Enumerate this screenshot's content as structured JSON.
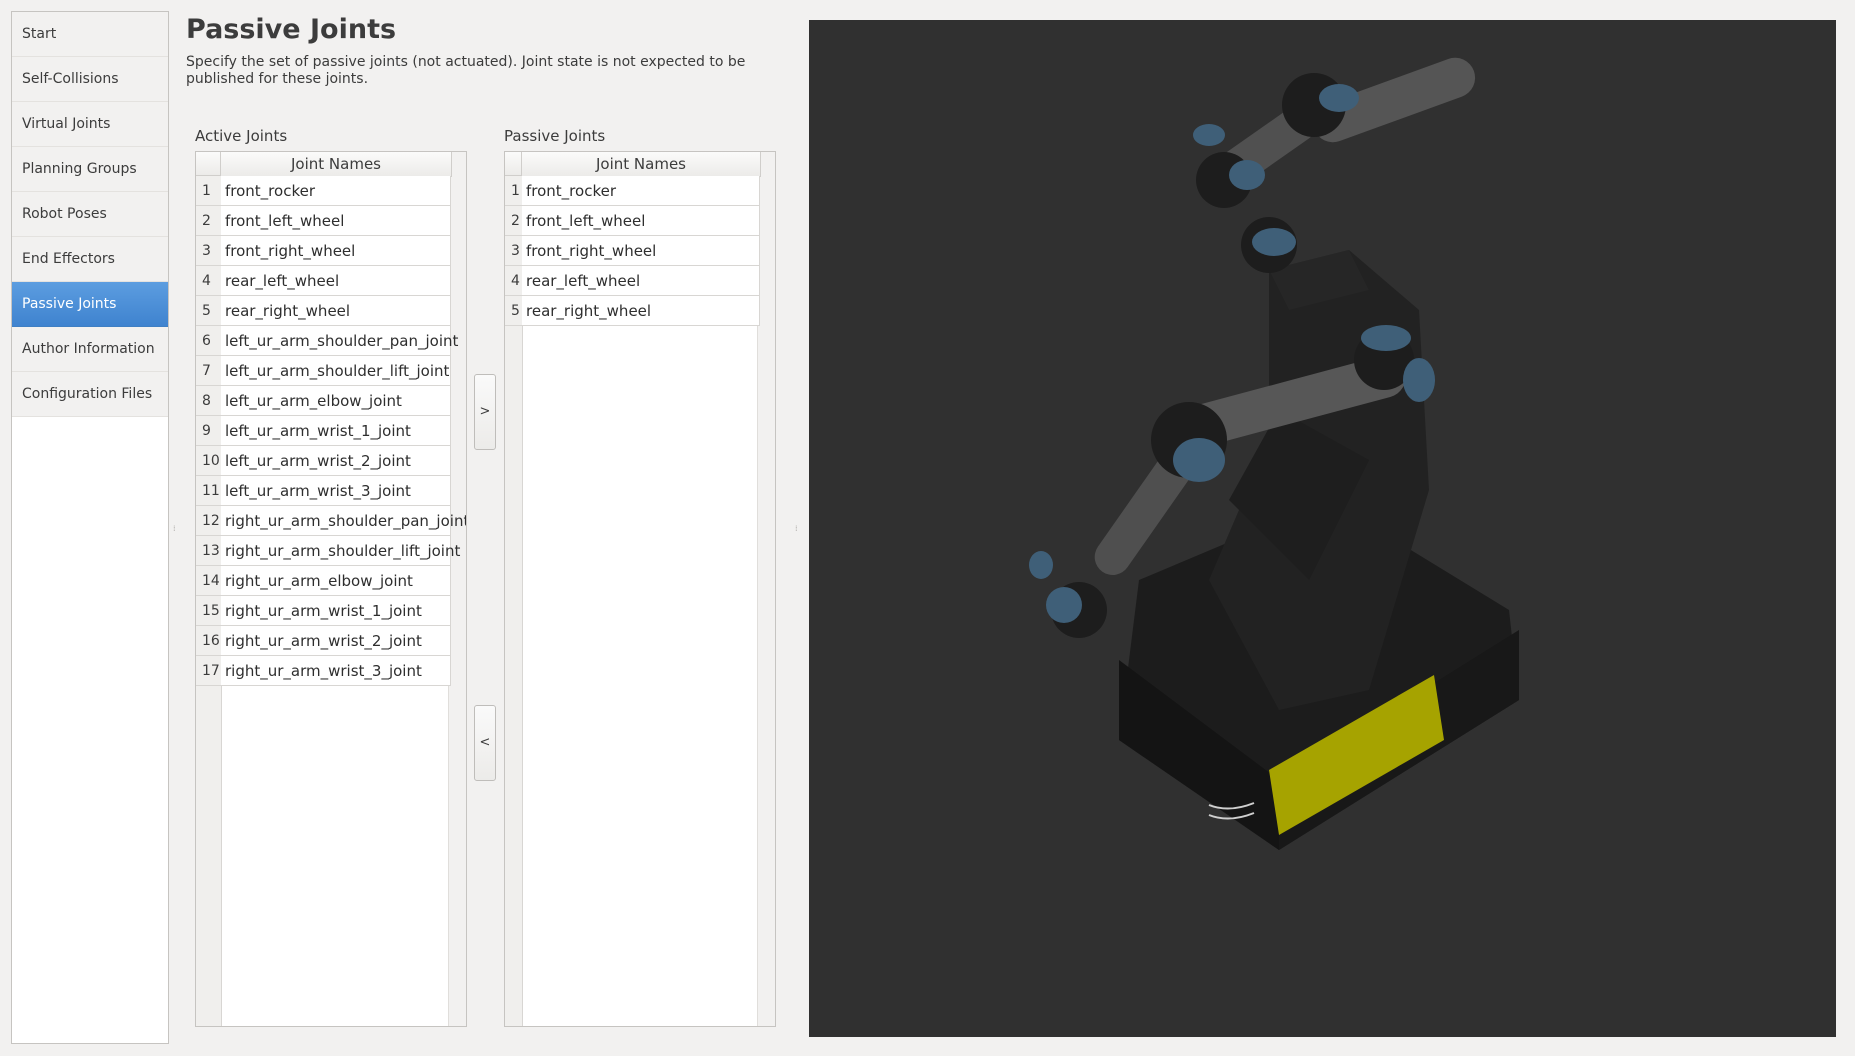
{
  "sidebar": {
    "items": [
      {
        "label": "Start"
      },
      {
        "label": "Self-Collisions"
      },
      {
        "label": "Virtual Joints"
      },
      {
        "label": "Planning Groups"
      },
      {
        "label": "Robot Poses"
      },
      {
        "label": "End Effectors"
      },
      {
        "label": "Passive Joints"
      },
      {
        "label": "Author Information"
      },
      {
        "label": "Configuration Files"
      }
    ],
    "active_label": "Passive Joints"
  },
  "header": {
    "title": "Passive Joints",
    "description": "Specify the set of passive joints (not actuated). Joint state is not expected to be published for these joints."
  },
  "active_joints": {
    "label": "Active Joints",
    "column_header": "Joint Names",
    "rows": [
      {
        "num": "1",
        "name": "front_rocker"
      },
      {
        "num": "2",
        "name": "front_left_wheel"
      },
      {
        "num": "3",
        "name": "front_right_wheel"
      },
      {
        "num": "4",
        "name": "rear_left_wheel"
      },
      {
        "num": "5",
        "name": "rear_right_wheel"
      },
      {
        "num": "6",
        "name": "left_ur_arm_shoulder_pan_joint"
      },
      {
        "num": "7",
        "name": "left_ur_arm_shoulder_lift_joint"
      },
      {
        "num": "8",
        "name": "left_ur_arm_elbow_joint"
      },
      {
        "num": "9",
        "name": "left_ur_arm_wrist_1_joint"
      },
      {
        "num": "10",
        "name": "left_ur_arm_wrist_2_joint"
      },
      {
        "num": "11",
        "name": "left_ur_arm_wrist_3_joint"
      },
      {
        "num": "12",
        "name": "right_ur_arm_shoulder_pan_joint"
      },
      {
        "num": "13",
        "name": "right_ur_arm_shoulder_lift_joint"
      },
      {
        "num": "14",
        "name": "right_ur_arm_elbow_joint"
      },
      {
        "num": "15",
        "name": "right_ur_arm_wrist_1_joint"
      },
      {
        "num": "16",
        "name": "right_ur_arm_wrist_2_joint"
      },
      {
        "num": "17",
        "name": "right_ur_arm_wrist_3_joint"
      }
    ]
  },
  "passive_joints": {
    "label": "Passive Joints",
    "column_header": "Joint Names",
    "rows": [
      {
        "num": "1",
        "name": "front_rocker"
      },
      {
        "num": "2",
        "name": "front_left_wheel"
      },
      {
        "num": "3",
        "name": "front_right_wheel"
      },
      {
        "num": "4",
        "name": "rear_left_wheel"
      },
      {
        "num": "5",
        "name": "rear_right_wheel"
      }
    ]
  },
  "buttons": {
    "move_right": ">",
    "move_left": "<"
  },
  "colors": {
    "accent": "#4a90d9",
    "viewport_bg": "#303030",
    "robot_body": "#1f1f1f",
    "joint_cap": "#3f5f78",
    "bumper": "#b5b300"
  }
}
